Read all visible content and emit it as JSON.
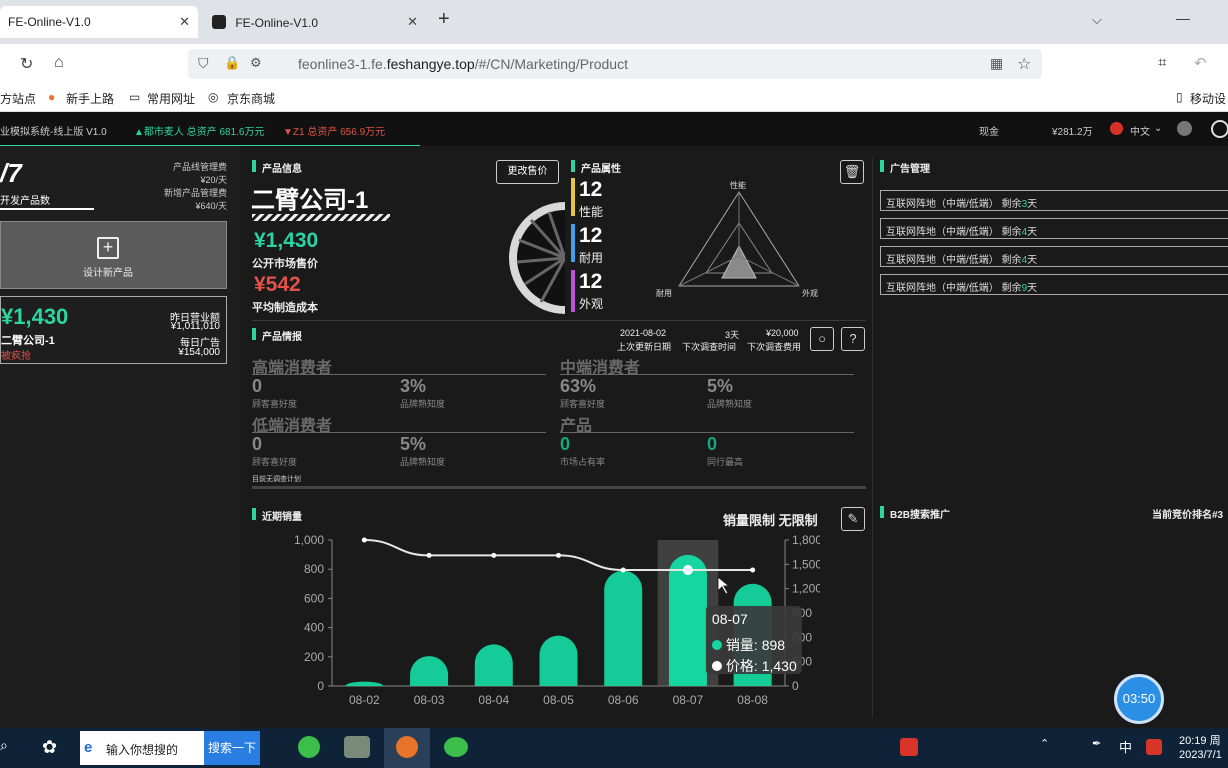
{
  "browser": {
    "tabs": [
      {
        "title": "FE-Online-V1.0",
        "active": true
      },
      {
        "title": "FE-Online-V1.0",
        "active": false
      }
    ],
    "new_tab": "+",
    "url_host_pre": "feonline3-1.fe.",
    "url_host_main": "feshangye.top",
    "url_path": "/#/CN/Marketing/Product",
    "bookmarks": [
      "方站点",
      "新手上路",
      "常用网址",
      "京东商城"
    ],
    "mobile_bm": "移动设"
  },
  "app": {
    "system_name": "业模拟系统-线上版 V1.0",
    "ticker_up": "▲都市麦人 总资产 681.6万元",
    "ticker_down": "▼Z1 总资产 656.9万元",
    "cash_label": "现金",
    "cash_value": "¥281.2万",
    "language": "中文"
  },
  "left": {
    "dev_count": "/7",
    "dev_label": "开发产品数",
    "line_mgr_label": "产品线管理费",
    "line_mgr_value": "¥20/天",
    "new_mgr_label": "新增产品管理费",
    "new_mgr_value": "¥640/天",
    "design_new": "设计新产品",
    "price": "¥1,430",
    "product": "二臂公司-1",
    "status": "被疯抢",
    "yesterday_rev_label": "昨日营业额",
    "yesterday_rev_value": "¥1,011,010",
    "daily_ad_label": "每日广告",
    "daily_ad_value": "¥154,000"
  },
  "product_info": {
    "section": "产品信息",
    "change_price": "更改售价",
    "name": "二臂公司-1",
    "market_price": "¥1,430",
    "market_price_label": "公开市场售价",
    "cost": "¥542",
    "cost_label": "平均制造成本"
  },
  "attributes": {
    "section": "产品属性",
    "items": [
      {
        "value": "12",
        "label": "性能",
        "color": "#e8c640"
      },
      {
        "value": "12",
        "label": "耐用",
        "color": "#3ea0e8"
      },
      {
        "value": "12",
        "label": "外观",
        "color": "#c050d8"
      }
    ],
    "radar_labels": [
      "性能",
      "耐用",
      "外观"
    ]
  },
  "intel": {
    "section": "产品情报",
    "update_date": "2021-08-02",
    "update_date_label": "上次更新日期",
    "next_survey": "3天",
    "next_survey_label": "下次调查时间",
    "next_cost": "¥20,000",
    "next_cost_label": "下次调查费用",
    "high": {
      "title": "高端消费者",
      "pref": "0",
      "pref_label": "顾客喜好度",
      "brand": "3%",
      "brand_label": "品牌熟知度"
    },
    "mid": {
      "title": "中端消费者",
      "pref": "63%",
      "pref_label": "顾客喜好度",
      "brand": "5%",
      "brand_label": "品牌熟知度"
    },
    "low": {
      "title": "低端消费者",
      "pref": "0",
      "pref_label": "顾客喜好度",
      "brand": "5%",
      "brand_label": "品牌熟知度"
    },
    "product": {
      "title": "产品",
      "share": "0",
      "share_label": "市场占有率",
      "peer": "0",
      "peer_label": "同行最高"
    },
    "no_plan": "目前无调查计划"
  },
  "sales": {
    "section": "近期销量",
    "limit_label": "销量限制 无限制"
  },
  "chart_data": {
    "type": "bar",
    "categories": [
      "08-02",
      "08-03",
      "08-04",
      "08-05",
      "08-06",
      "08-07",
      "08-08"
    ],
    "series": [
      {
        "name": "销量",
        "type": "bar",
        "axis": "left",
        "values": [
          30,
          205,
          285,
          345,
          790,
          898,
          700
        ]
      },
      {
        "name": "价格",
        "type": "line",
        "axis": "right",
        "values": [
          1800,
          1610,
          1610,
          1610,
          1430,
          1430,
          1430
        ]
      }
    ],
    "y_left": {
      "ticks": [
        "0",
        "200",
        "400",
        "600",
        "800",
        "1,000"
      ],
      "range": [
        0,
        1000
      ]
    },
    "y_right": {
      "ticks": [
        "0",
        "300",
        "600",
        "900",
        "1,200",
        "1,500",
        "1,800"
      ],
      "range": [
        0,
        1800
      ]
    },
    "highlight_index": 5,
    "tooltip": {
      "date": "08-07",
      "sales_label": "销量: 898",
      "price_label": "价格: 1,430"
    },
    "colors": {
      "bar": "#15d6a0",
      "line": "#e6e6e6"
    }
  },
  "ads": {
    "section": "广告管理",
    "items": [
      {
        "text": "互联网阵地（中端/低端） 剩余",
        "num": "3",
        "unit": "天"
      },
      {
        "text": "互联网阵地（中端/低端） 剩余",
        "num": "4",
        "unit": "天"
      },
      {
        "text": "互联网阵地（中端/低端） 剩余",
        "num": "4",
        "unit": "天"
      },
      {
        "text": "互联网阵地（中端/低端） 剩余",
        "num": "9",
        "unit": "天"
      }
    ]
  },
  "b2b": {
    "section": "B2B搜索推广",
    "rank": "当前竞价排名#3"
  },
  "timer": "03:50",
  "taskbar": {
    "search_placeholder": "输入你想搜的",
    "search_btn": "搜索一下",
    "time": "20:19 周",
    "date": "2023/7/1",
    "ime": "中"
  }
}
